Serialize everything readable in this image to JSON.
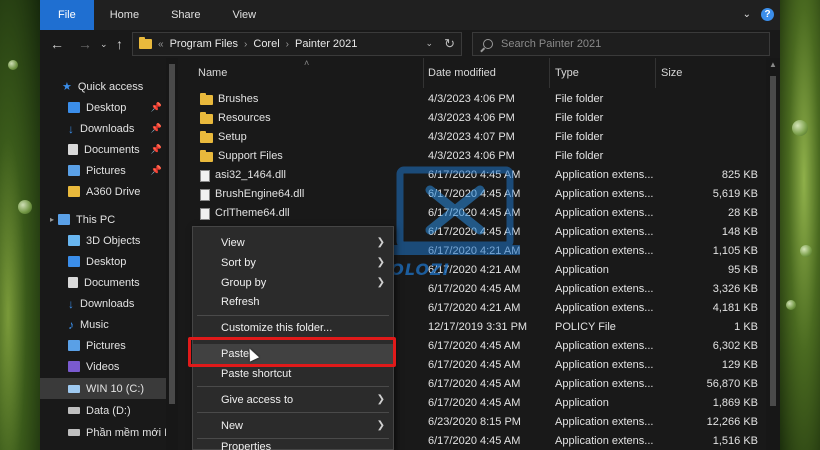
{
  "ribbon": {
    "tabs": [
      {
        "label": "File"
      },
      {
        "label": "Home"
      },
      {
        "label": "Share"
      },
      {
        "label": "View"
      }
    ],
    "help_label": "?"
  },
  "address": {
    "overflow": "«",
    "crumbs": [
      "Program Files",
      "Corel",
      "Painter 2021"
    ],
    "search_placeholder": "Search Painter 2021"
  },
  "navpane": {
    "items": [
      {
        "label": "Quick access",
        "icon": "star-icon",
        "pinned": false
      },
      {
        "label": "Desktop",
        "icon": "desktop-icon",
        "pinned": true
      },
      {
        "label": "Downloads",
        "icon": "download-icon",
        "pinned": true
      },
      {
        "label": "Documents",
        "icon": "documents-icon",
        "pinned": true
      },
      {
        "label": "Pictures",
        "icon": "pictures-icon",
        "pinned": true
      },
      {
        "label": "A360 Drive",
        "icon": "folder-icon",
        "pinned": false
      },
      {
        "label": "This PC",
        "icon": "pc-icon",
        "pinned": false
      },
      {
        "label": "3D Objects",
        "icon": "cube-icon",
        "pinned": false
      },
      {
        "label": "Desktop",
        "icon": "desktop-icon",
        "pinned": false
      },
      {
        "label": "Documents",
        "icon": "documents-icon",
        "pinned": false
      },
      {
        "label": "Downloads",
        "icon": "download-icon",
        "pinned": false
      },
      {
        "label": "Music",
        "icon": "music-icon",
        "pinned": false
      },
      {
        "label": "Pictures",
        "icon": "pictures-icon",
        "pinned": false
      },
      {
        "label": "Videos",
        "icon": "video-icon",
        "pinned": false
      },
      {
        "label": "WIN 10 (C:)",
        "icon": "drive-icon",
        "pinned": false
      },
      {
        "label": "Data (D:)",
        "icon": "drive-icon",
        "pinned": false
      },
      {
        "label": "Phần mềm mới I",
        "icon": "drive-icon",
        "pinned": false
      }
    ]
  },
  "list": {
    "headers": {
      "name": "Name",
      "date": "Date modified",
      "type": "Type",
      "size": "Size"
    },
    "rows": [
      {
        "name": "Brushes",
        "date": "4/3/2023 4:06 PM",
        "type": "File folder",
        "size": "",
        "kind": "folder"
      },
      {
        "name": "Resources",
        "date": "4/3/2023 4:06 PM",
        "type": "File folder",
        "size": "",
        "kind": "folder"
      },
      {
        "name": "Setup",
        "date": "4/3/2023 4:07 PM",
        "type": "File folder",
        "size": "",
        "kind": "folder"
      },
      {
        "name": "Support Files",
        "date": "4/3/2023 4:06 PM",
        "type": "File folder",
        "size": "",
        "kind": "folder"
      },
      {
        "name": "asi32_1464.dll",
        "date": "6/17/2020 4:45 AM",
        "type": "Application extens...",
        "size": "825 KB",
        "kind": "file"
      },
      {
        "name": "BrushEngine64.dll",
        "date": "6/17/2020 4:45 AM",
        "type": "Application extens...",
        "size": "5,619 KB",
        "kind": "file"
      },
      {
        "name": "CrlTheme64.dll",
        "date": "6/17/2020 4:45 AM",
        "type": "Application extens...",
        "size": "28 KB",
        "kind": "file"
      },
      {
        "name": "",
        "date": "6/17/2020 4:45 AM",
        "type": "Application extens...",
        "size": "148 KB",
        "kind": "file"
      },
      {
        "name": "",
        "date": "6/17/2020 4:21 AM",
        "type": "Application extens...",
        "size": "1,105 KB",
        "kind": "file"
      },
      {
        "name": "",
        "date": "6/17/2020 4:21 AM",
        "type": "Application",
        "size": "95 KB",
        "kind": "file"
      },
      {
        "name": "",
        "date": "6/17/2020 4:45 AM",
        "type": "Application extens...",
        "size": "3,326 KB",
        "kind": "file"
      },
      {
        "name": "",
        "date": "6/17/2020 4:21 AM",
        "type": "Application extens...",
        "size": "4,181 KB",
        "kind": "file"
      },
      {
        "name": "",
        "date": "12/17/2019 3:31 PM",
        "type": "POLICY File",
        "size": "1 KB",
        "kind": "file"
      },
      {
        "name": "",
        "date": "6/17/2020 4:45 AM",
        "type": "Application extens...",
        "size": "6,302 KB",
        "kind": "file"
      },
      {
        "name": "",
        "date": "6/17/2020 4:45 AM",
        "type": "Application extens...",
        "size": "129 KB",
        "kind": "file"
      },
      {
        "name": "",
        "date": "6/17/2020 4:45 AM",
        "type": "Application extens...",
        "size": "56,870 KB",
        "kind": "file"
      },
      {
        "name": "",
        "date": "6/17/2020 4:45 AM",
        "type": "Application",
        "size": "1,869 KB",
        "kind": "file"
      },
      {
        "name": "",
        "date": "6/23/2020 8:15 PM",
        "type": "Application extens...",
        "size": "12,266 KB",
        "kind": "file"
      },
      {
        "name": "",
        "date": "6/17/2020 4:45 AM",
        "type": "Application extens...",
        "size": "1,516 KB",
        "kind": "file"
      }
    ]
  },
  "context_menu": {
    "items": [
      {
        "label": "View",
        "submenu": true
      },
      {
        "label": "Sort by",
        "submenu": true
      },
      {
        "label": "Group by",
        "submenu": true
      },
      {
        "label": "Refresh",
        "submenu": false
      },
      {
        "label": "Customize this folder...",
        "submenu": false
      },
      {
        "label": "Paste",
        "submenu": false
      },
      {
        "label": "Paste shortcut",
        "submenu": false
      },
      {
        "label": "Give access to",
        "submenu": true
      },
      {
        "label": "New",
        "submenu": true
      },
      {
        "label": "Properties",
        "submenu": false
      }
    ]
  },
  "watermark": {
    "text": "DOLOZI"
  },
  "colors": {
    "accent": "#1f6fd1",
    "highlight_box": "#e01a1a",
    "folder": "#e9b93c"
  }
}
